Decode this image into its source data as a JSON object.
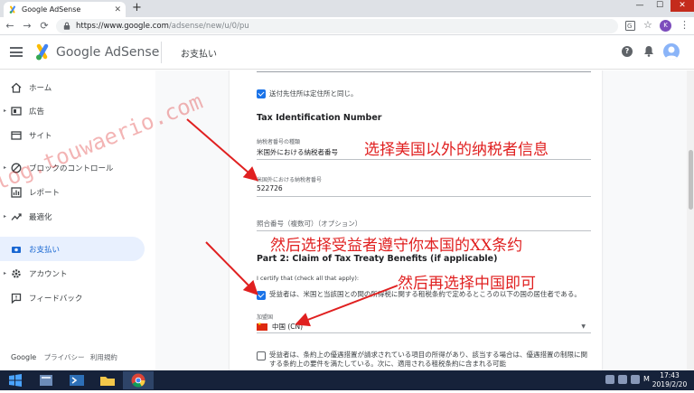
{
  "browser": {
    "tab_title": "Google AdSense",
    "new_tab": "+",
    "url_host": "https://www.google.com",
    "url_path": "/adsense/new/u/0/pu",
    "profile_letter": "K"
  },
  "header": {
    "brand": "Google AdSense",
    "page_title": "お支払い"
  },
  "sidebar": {
    "items": [
      {
        "label": "ホーム",
        "icon": "home-icon"
      },
      {
        "label": "広告",
        "icon": "ads-icon"
      },
      {
        "label": "サイト",
        "icon": "sites-icon"
      },
      {
        "label": "ブロックのコントロール",
        "icon": "block-icon"
      },
      {
        "label": "レポート",
        "icon": "reports-icon"
      },
      {
        "label": "最適化",
        "icon": "optimize-icon"
      },
      {
        "label": "お支払い",
        "icon": "payments-icon"
      },
      {
        "label": "アカウント",
        "icon": "account-icon"
      },
      {
        "label": "フィードバック",
        "icon": "feedback-icon"
      }
    ],
    "footer": {
      "google": "Google",
      "privacy": "プライバシー",
      "terms": "利用規約"
    }
  },
  "form": {
    "same_address_label": "送付先住所は定住所と同じ。",
    "tin_heading": "Tax Identification Number",
    "tin_type_label": "納税者番号の種類",
    "tin_type_value": "米国外における納税者番号",
    "foreign_tin_label": "米国外における納税者番号",
    "foreign_tin_value": "522726",
    "reference_number_label": "照合番号（複数可）（オプション）",
    "part2_heading": "Part 2: Claim of Tax Treaty Benefits (if applicable)",
    "certify_label": "I certify that (check all that apply):",
    "treaty_checkbox_text": "受益者は、米国と当該国との間の所得税に関する租税条約で定めるところの以下の国の居住者である。",
    "country_label": "加盟国",
    "country_value": "中国 (CN)",
    "lob_checkbox_text": "受益者は、条約上の優遇措置が請求されている項目の所得があり、該当する場合は、優遇措置の制限に関する条約上の要件を満たしている。次に、適用される租税条約に含まれる可能"
  },
  "annotations": {
    "note1": "选择美国以外的纳税者信息",
    "note2": "然后选择受益者遵守你本国的XX条约",
    "note3": "然后再选择中国即可",
    "watermark": "log.touwaerio.com"
  },
  "taskbar": {
    "time": "17:43",
    "date": "2019/2/20",
    "ime": "M"
  },
  "colors": {
    "accent": "#1a73e8",
    "annotation": "#e02020",
    "active_nav_bg": "#e8f0fe"
  }
}
